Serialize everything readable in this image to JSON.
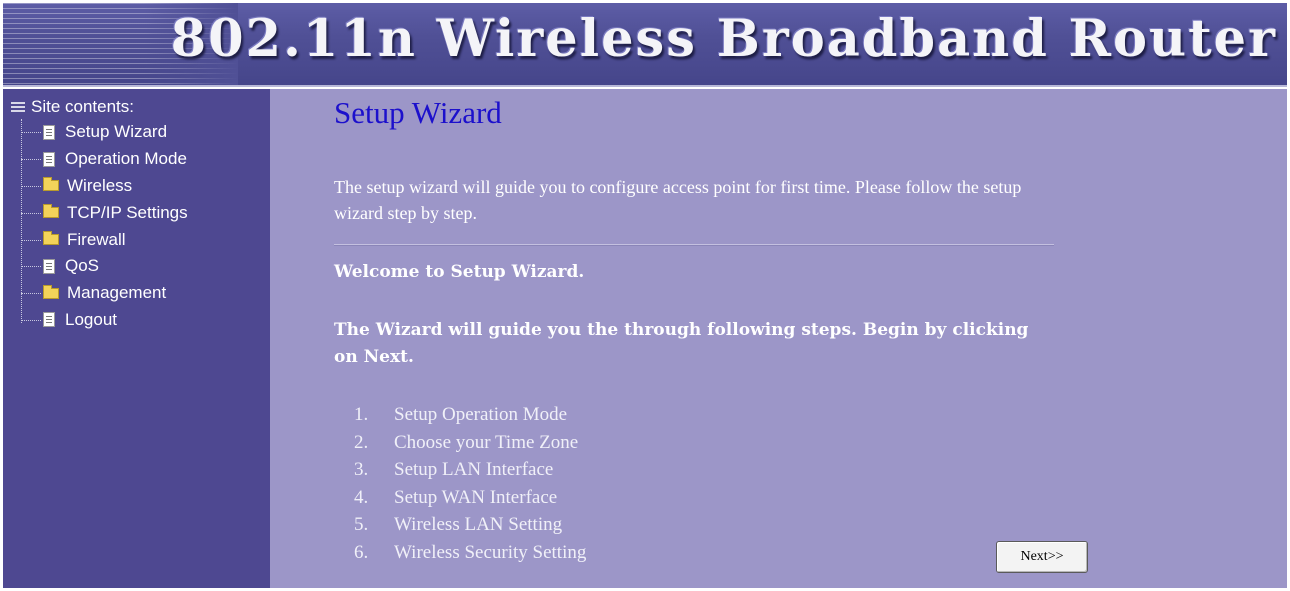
{
  "banner": {
    "title": "802.11n   Wireless  Broadband  Router"
  },
  "sidebar": {
    "heading": "Site contents:",
    "items": [
      {
        "label": "Setup Wizard",
        "icon": "document-icon"
      },
      {
        "label": "Operation Mode",
        "icon": "document-icon"
      },
      {
        "label": "Wireless",
        "icon": "folder-icon"
      },
      {
        "label": "TCP/IP Settings",
        "icon": "folder-icon"
      },
      {
        "label": "Firewall",
        "icon": "folder-icon"
      },
      {
        "label": "QoS",
        "icon": "document-icon"
      },
      {
        "label": "Management",
        "icon": "folder-icon"
      },
      {
        "label": "Logout",
        "icon": "document-icon"
      }
    ]
  },
  "main": {
    "title": "Setup Wizard",
    "intro": "The setup wizard will guide you to configure access point for first time. Please follow the setup wizard step by step.",
    "welcome": "Welcome to Setup Wizard.",
    "guide": "The Wizard will guide you the through following steps. Begin by clicking on Next.",
    "steps": [
      {
        "num": "1.",
        "label": "Setup Operation Mode"
      },
      {
        "num": "2.",
        "label": "Choose your Time Zone"
      },
      {
        "num": "3.",
        "label": "Setup LAN Interface"
      },
      {
        "num": "4.",
        "label": "Setup WAN Interface"
      },
      {
        "num": "5.",
        "label": "Wireless LAN Setting"
      },
      {
        "num": "6.",
        "label": "Wireless Security Setting"
      }
    ],
    "next_label": "Next>>"
  },
  "colors": {
    "banner_bg": "#505096",
    "sidebar_bg": "#4e4891",
    "main_bg": "#9c96c8",
    "title_color": "#1c10cc"
  }
}
